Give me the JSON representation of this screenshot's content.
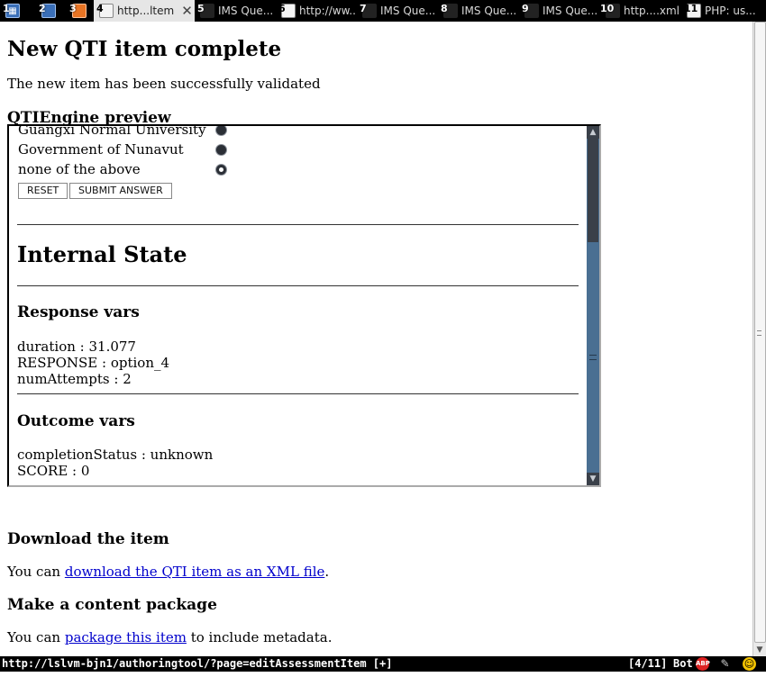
{
  "tabs": [
    {
      "num": "1",
      "label": "",
      "icon": "calendar-icon",
      "active": false
    },
    {
      "num": "2",
      "label": "",
      "icon": "document-icon",
      "active": false
    },
    {
      "num": "3",
      "label": "",
      "icon": "orange-app-icon",
      "active": false
    },
    {
      "num": "4",
      "label": "http...ltem",
      "icon": "document-icon",
      "active": true
    },
    {
      "num": "5",
      "label": "IMS Que...",
      "icon": "ims-icon",
      "active": false
    },
    {
      "num": "6",
      "label": "http://ww...",
      "icon": "document-icon",
      "active": false
    },
    {
      "num": "7",
      "label": "IMS Que...",
      "icon": "ims-icon",
      "active": false
    },
    {
      "num": "8",
      "label": "IMS Que...",
      "icon": "ims-icon",
      "active": false
    },
    {
      "num": "9",
      "label": "IMS Que...",
      "icon": "ims-icon",
      "active": false
    },
    {
      "num": "10",
      "label": "http....xml",
      "icon": "ims-icon",
      "active": false
    },
    {
      "num": "11",
      "label": "PHP: us...",
      "icon": "php-icon",
      "active": false
    }
  ],
  "page": {
    "title": "New QTI item complete",
    "validated_text": "The new item has been successfully validated",
    "preview_heading": "QTIEngine preview",
    "download_heading": "Download the item",
    "download_prefix": "You can ",
    "download_link": "download the QTI item as an XML file",
    "download_suffix": ".",
    "package_heading": "Make a content package",
    "package_prefix": "You can ",
    "package_link": "package this item",
    "package_suffix": " to include metadata."
  },
  "preview": {
    "choices": [
      {
        "label": "Guangxi Normal University",
        "selected": false
      },
      {
        "label": "Government of Nunavut",
        "selected": false
      },
      {
        "label": "none of the above",
        "selected": true
      }
    ],
    "reset_label": "RESET",
    "submit_label": "SUBMIT ANSWER",
    "internal_state_title": "Internal State",
    "response_vars_title": "Response vars",
    "response_vars": [
      "duration : 31.077",
      "RESPONSE : option_4",
      "numAttempts : 2"
    ],
    "outcome_vars_title": "Outcome vars",
    "outcome_vars": [
      "completionStatus : unknown",
      "SCORE : 0"
    ]
  },
  "status": {
    "url": "http://lslvm-bjn1/authoringtool/?page=editAssessmentItem [+]",
    "tab_position": "[4/11]",
    "scroll_position": "Bot",
    "abp_label": "ABP"
  },
  "colors": {
    "link": "#0000cc",
    "tabbar_bg": "#000000",
    "active_tab_bg": "#e6e6e6",
    "scrollbar_track": "#4a6f92"
  }
}
